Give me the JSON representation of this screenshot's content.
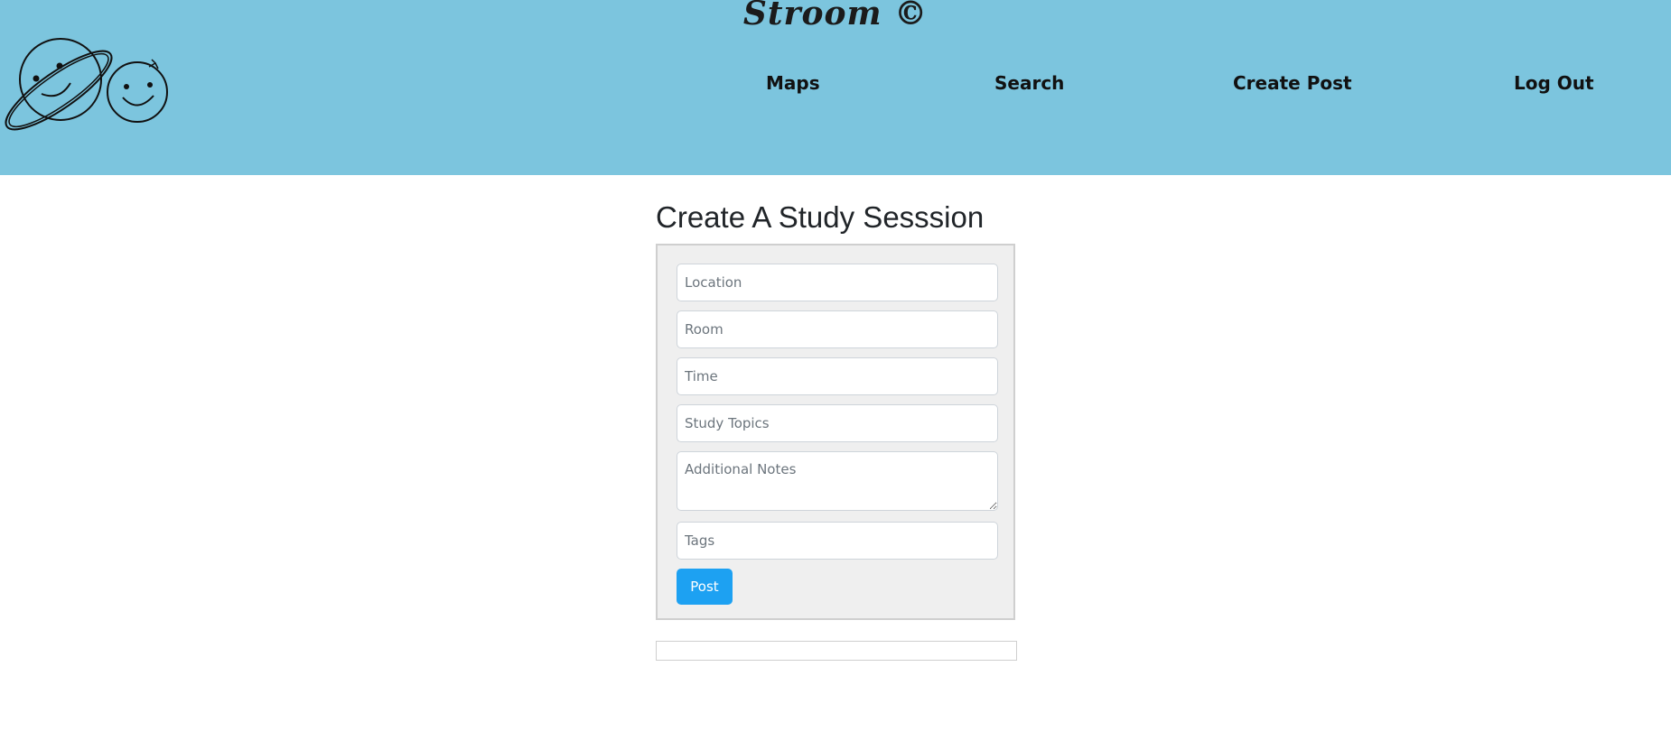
{
  "header": {
    "brand": "Stroom ©",
    "logo_icon": "planets-smiley-logo-icon",
    "background_color": "#7cc5de",
    "nav": [
      {
        "label": "Maps"
      },
      {
        "label": "Search"
      },
      {
        "label": "Create Post"
      },
      {
        "label": "Log Out"
      }
    ]
  },
  "main": {
    "title": "Create A Study Sesssion",
    "form": {
      "location_placeholder": "Location",
      "room_placeholder": "Room",
      "time_placeholder": "Time",
      "topics_placeholder": "Study Topics",
      "notes_placeholder": "Additional Notes",
      "tags_placeholder": "Tags",
      "submit_label": "Post",
      "submit_color": "#1da1f2"
    }
  }
}
